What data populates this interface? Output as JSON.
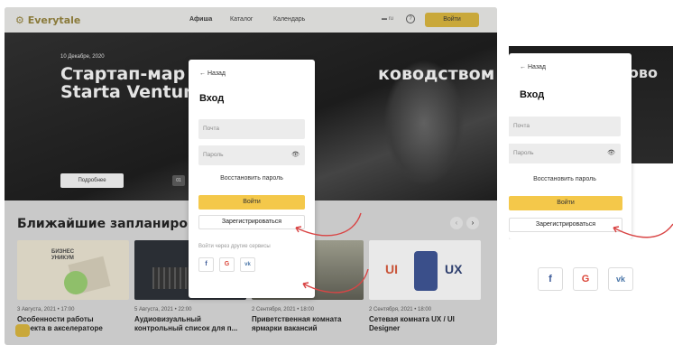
{
  "site": {
    "logo": "⚙ Everytale",
    "nav": [
      "Афиша",
      "Каталог",
      "Календарь"
    ],
    "lang": "▬ ru",
    "help": "?",
    "login_button": "Войти"
  },
  "hero": {
    "date": "10 Декабре, 2020",
    "title_line1": "Стартап-мар",
    "title_line1_right": "ководством",
    "title_line2": "Starta Ventur",
    "button": "Подробнее",
    "badge": "01"
  },
  "section": {
    "title": "Ближайшие запланированны",
    "prev": "‹",
    "next": "›"
  },
  "cards": [
    {
      "date": "3 Августа, 2021 • 17:00",
      "title": "Особенности работы\nпроекта в акселераторе",
      "img_color": "#d9d3c2",
      "img_text": "БИЗНЕС\nУНИКУМ"
    },
    {
      "date": "5 Августа, 2021 • 22:00",
      "title": "Аудиовизуальный\nконтрольный список для п...",
      "img_color": "#2a2e34",
      "img_text": ""
    },
    {
      "date": "2 Сентября, 2021 • 18:00",
      "title": "Приветственная комната\nярмарки вакансий",
      "img_color": "#8a8a7a",
      "img_text": ""
    },
    {
      "date": "2 Сентября, 2021 • 18:00",
      "title": "Сетевая комната UX / UI\nDesigner",
      "img_color": "#e9e9e9",
      "img_text": "UI   UX"
    }
  ],
  "modal": {
    "back": "← Назад",
    "title": "Вход",
    "email_placeholder": "Почта",
    "password_placeholder": "Пароль",
    "eye": "👁",
    "restore": "Восстановить пароль",
    "login": "Войти",
    "register": "Зарегистрироваться",
    "social_label": "Войти через другие сервисы",
    "social": [
      "f",
      "G",
      "vk"
    ]
  },
  "right": {
    "hero_text": "ково",
    "social": [
      "f",
      "G",
      "vk"
    ]
  },
  "colors": {
    "accent": "#f4c84a",
    "dark_accent": "#c9a83a",
    "arrow": "#d94545",
    "facebook": "#3b5998",
    "google": "#db4437",
    "vk": "#4a76a8"
  }
}
